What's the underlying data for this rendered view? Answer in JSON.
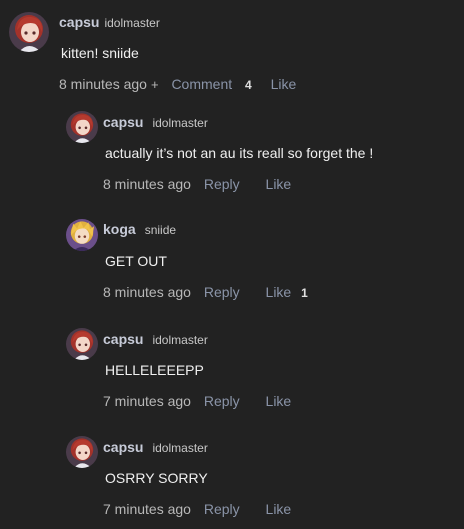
{
  "comments": [
    {
      "username": "capsu",
      "usertag": "idolmaster",
      "text": "kitten! sniide",
      "time": "8 minutes ago",
      "plus": "+",
      "action": "Comment",
      "action_count": "4",
      "like": "Like",
      "like_count": "",
      "avatar_icon": "red-haired-girl-avatar-icon"
    },
    {
      "username": "capsu",
      "usertag": "idolmaster",
      "text": "actually it’s not an au its reall so forget the !",
      "time": "8 minutes ago",
      "action": "Reply",
      "like": "Like",
      "like_count": "",
      "avatar_icon": "red-haired-girl-avatar-icon"
    },
    {
      "username": "koga",
      "usertag": "sniide",
      "text": "GET OUT",
      "time": "8 minutes ago",
      "action": "Reply",
      "like": "Like",
      "like_count": "1",
      "avatar_icon": "blonde-boy-avatar-icon"
    },
    {
      "username": "capsu",
      "usertag": "idolmaster",
      "text": "HELLELEEEPP",
      "time": "7 minutes ago",
      "action": "Reply",
      "like": "Like",
      "like_count": "",
      "avatar_icon": "red-haired-girl-avatar-icon"
    },
    {
      "username": "capsu",
      "usertag": "idolmaster",
      "text": "OSRRY SORRY",
      "time": "7 minutes ago",
      "action": "Reply",
      "like": "Like",
      "like_count": "",
      "avatar_icon": "red-haired-girl-avatar-icon"
    }
  ],
  "colors": {
    "background": "#222222",
    "username": "#c7cbd8",
    "link": "#8a94a8",
    "text": "#f0f0f0"
  }
}
